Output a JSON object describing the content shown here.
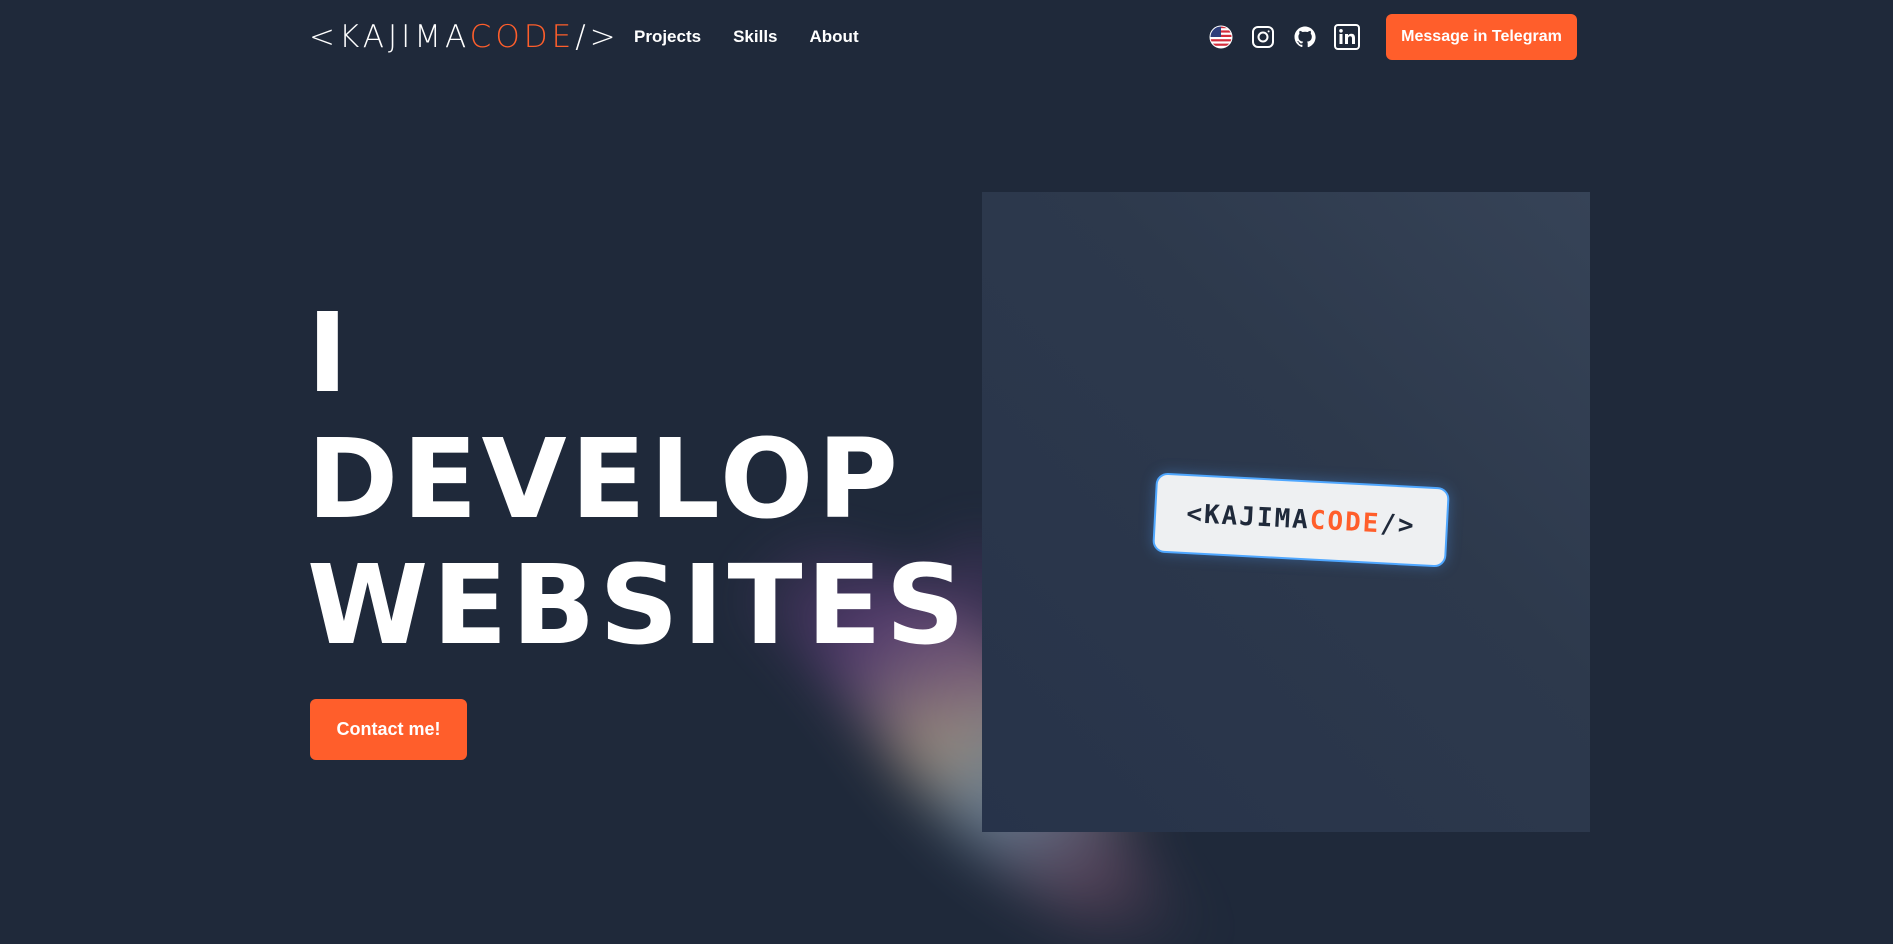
{
  "header": {
    "logo": {
      "prefix": "<KAJIMA",
      "accent": "CODE",
      "suffix": "/>"
    },
    "nav": [
      {
        "label": "Projects"
      },
      {
        "label": "Skills"
      },
      {
        "label": "About"
      }
    ],
    "icons": [
      "us-flag-icon",
      "instagram-icon",
      "github-icon",
      "linkedin-icon"
    ],
    "telegram_button": "Message in Telegram"
  },
  "hero": {
    "headline": [
      "I",
      "DEVELOP",
      "WEBSITES"
    ],
    "contact_button": "Contact me!",
    "badge": {
      "prefix": "<KAJIMA",
      "accent": "CODE",
      "suffix": "/>"
    }
  },
  "colors": {
    "background": "#1f293a",
    "accent": "#ff5e2b",
    "panel": "#2d394c",
    "text": "#ffffff"
  }
}
